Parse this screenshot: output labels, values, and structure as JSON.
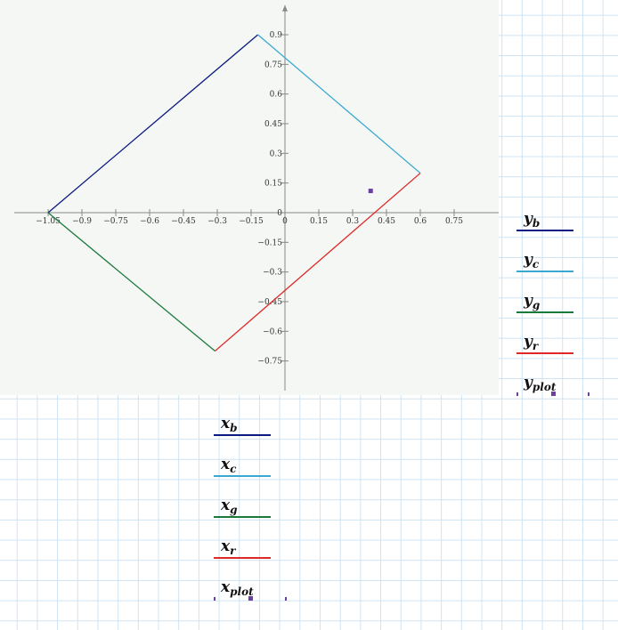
{
  "chart_data": {
    "type": "line",
    "xlim": [
      -1.2,
      1.05
    ],
    "ylim": [
      -0.9,
      1.05
    ],
    "x_ticks": [
      "−1.05",
      "−0.9",
      "−0.75",
      "−0.6",
      "−0.45",
      "−0.3",
      "−0.15",
      "0",
      "0.15",
      "0.3",
      "0.45",
      "0.6",
      "0.75"
    ],
    "x_tick_values": [
      -1.05,
      -0.9,
      -0.75,
      -0.6,
      -0.45,
      -0.3,
      -0.15,
      0,
      0.15,
      0.3,
      0.45,
      0.6,
      0.75
    ],
    "y_ticks": [
      "0.9",
      "0.75",
      "0.6",
      "0.45",
      "0.3",
      "0.15",
      "0",
      "−0.15",
      "−0.3",
      "−0.45",
      "−0.6",
      "−0.75"
    ],
    "y_tick_values": [
      0.9,
      0.75,
      0.6,
      0.45,
      0.3,
      0.15,
      0,
      -0.15,
      -0.3,
      -0.45,
      -0.6,
      -0.75
    ],
    "series": [
      {
        "id": "b",
        "color": "#0a1a80",
        "x": [
          -1.05,
          -0.12
        ],
        "y": [
          0.0,
          0.9
        ]
      },
      {
        "id": "c",
        "color": "#3aa8d0",
        "x": [
          -0.12,
          0.6
        ],
        "y": [
          0.9,
          0.2
        ]
      },
      {
        "id": "g",
        "color": "#1a7a3c",
        "x": [
          -1.05,
          -0.31
        ],
        "y": [
          0.0,
          -0.7
        ]
      },
      {
        "id": "r",
        "color": "#e02828",
        "x": [
          -0.31,
          0.6
        ],
        "y": [
          -0.7,
          0.2
        ]
      },
      {
        "id": "plot",
        "color": "#6b3fa0",
        "marker": "square",
        "x": [
          0.38
        ],
        "y": [
          0.11
        ]
      }
    ]
  },
  "y_legend": [
    {
      "base": "y",
      "sub": "b",
      "color": "#0a1a80",
      "style": "line"
    },
    {
      "base": "y",
      "sub": "c",
      "color": "#3aa8d0",
      "style": "line"
    },
    {
      "base": "y",
      "sub": "g",
      "color": "#1a7a3c",
      "style": "line"
    },
    {
      "base": "y",
      "sub": "r",
      "color": "#e02828",
      "style": "line"
    },
    {
      "base": "y",
      "sub": "plot",
      "color": "#6b3fa0",
      "style": "points"
    }
  ],
  "x_legend": [
    {
      "base": "x",
      "sub": "b",
      "color": "#0a1a80",
      "style": "line"
    },
    {
      "base": "x",
      "sub": "c",
      "color": "#3aa8d0",
      "style": "line"
    },
    {
      "base": "x",
      "sub": "g",
      "color": "#1a7a3c",
      "style": "line"
    },
    {
      "base": "x",
      "sub": "r",
      "color": "#e02828",
      "style": "line"
    },
    {
      "base": "x",
      "sub": "plot",
      "color": "#6b3fa0",
      "style": "points"
    }
  ]
}
